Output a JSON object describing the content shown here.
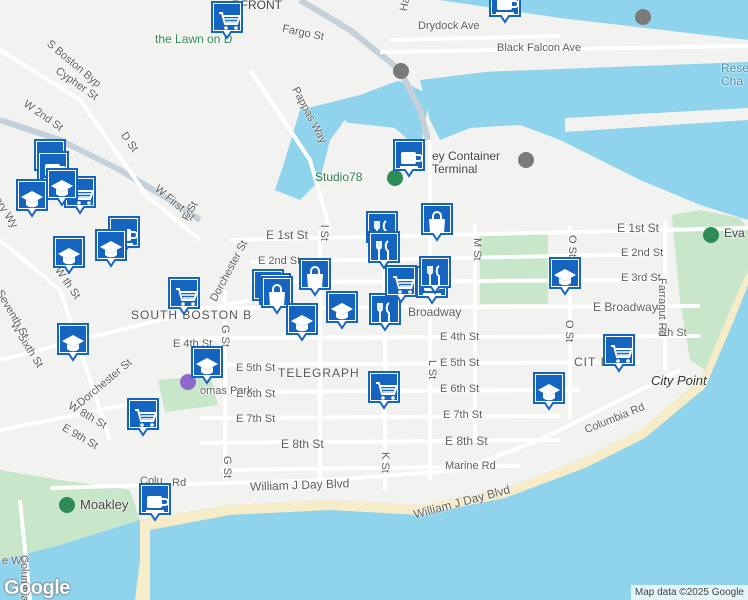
{
  "map": {
    "attribution": "Map data ©2025 Google",
    "logo_text": "Google",
    "colors": {
      "water": "#8fd3ec",
      "land": "#f2f2f0",
      "park": "#c8e6c9",
      "beach": "#f7ecc8",
      "road": "#ffffff",
      "highway": "#c5d1da",
      "marker": "#1565c0"
    },
    "labels": {
      "waterfront": "RFRONT",
      "drydock": "Drydock Ave",
      "black_falcon": "Black Falcon Ave",
      "fargo": "Fargo St",
      "lawn_on_d": "the Lawn on D",
      "boston_bypass": "S Boston Byp",
      "cypher": "Cypher St",
      "w2nd": "W 2nd St",
      "d_st": "D St",
      "pappas": "Pappas Way",
      "studio78": "Studio78",
      "container": "ey Container\nTerminal",
      "w_first": "W First St",
      "f_st": "F St",
      "e_1st": "E 1st St",
      "e_1st_r": "E 1st St",
      "e_2nd_l": "E 2nd St",
      "e_2nd_r": "E 2nd St",
      "e_3rd": "E 3rd St",
      "broadway": "Broadway",
      "e_broadway": "E Broadway",
      "south_boston": "SOUTH BOSTON B",
      "telegraph": "TELEGRAPH",
      "e_4th": "E 4th St",
      "e_4th_r": "4th St",
      "e_5th_l": "E 5th St",
      "e_5th_r": "E 5th St",
      "e_6th_l": "E 6th St",
      "e_6th_r": "E 6th St",
      "e_7th_l": "E 7th St",
      "e_7th_r": "E 7th St",
      "e_8th": "E 8th St",
      "e_8th_r": "E 8th St",
      "w_8th": "W 8th St",
      "e_9th": "E 9th St",
      "marine": "Marine Rd",
      "william_day": "William J Day Blvd",
      "william_day_r": "William J Day Blvd",
      "columbia": "Columbia Rd",
      "columbia_l": "Colu",
      "columbia_l2": "Rd",
      "city_point": "City Point",
      "city_pt_hood": "CIT    INT",
      "farragut": "Farragut Rd",
      "moakley": "Moakley",
      "dorchester": "Dorchester St",
      "dorchester2": "Dorchester St",
      "g_st": "G St",
      "g_st2": "G St",
      "k_st": "K St",
      "l_st": "L St",
      "m_st": "M St",
      "o_st": "O St",
      "thomas": "omas Park",
      "evans": "Eva",
      "reserved": "Rese\nCha",
      "harbor": "Har",
      "w_sixth": "W Sixth St",
      "seventh": "Seventh St",
      "ary_wy": "ery Wy",
      "wy": "e Wy",
      "e4th_small": "E 4th St",
      "w_th": "W th St",
      "e_2nd_c": "E 2nd St",
      "ist": "l St"
    },
    "markers": [
      {
        "icon": "cart-icon",
        "kind": "grocery"
      },
      {
        "icon": "coffee-icon",
        "kind": "cafe"
      },
      {
        "icon": "coffee-icon",
        "kind": "cafe"
      },
      {
        "icon": "coffee-icon",
        "kind": "cafe"
      },
      {
        "icon": "school-icon",
        "kind": "school"
      },
      {
        "icon": "cart-icon",
        "kind": "grocery"
      },
      {
        "icon": "school-icon",
        "kind": "school"
      },
      {
        "icon": "school-icon",
        "kind": "school"
      },
      {
        "icon": "coffee-icon",
        "kind": "cafe"
      },
      {
        "icon": "school-icon",
        "kind": "school"
      },
      {
        "icon": "cart-icon",
        "kind": "grocery"
      },
      {
        "icon": "school-icon",
        "kind": "school"
      },
      {
        "icon": "school-icon",
        "kind": "school"
      },
      {
        "icon": "cart-icon",
        "kind": "grocery"
      },
      {
        "icon": "coffee-icon",
        "kind": "cafe"
      },
      {
        "icon": "restaurant-icon",
        "kind": "restaurant"
      },
      {
        "icon": "bag-icon",
        "kind": "shopping"
      },
      {
        "icon": "restaurant-icon",
        "kind": "restaurant"
      },
      {
        "icon": "bag-icon",
        "kind": "shopping"
      },
      {
        "icon": "bag-icon",
        "kind": "shopping"
      },
      {
        "icon": "bag-icon",
        "kind": "shopping"
      },
      {
        "icon": "bag-icon",
        "kind": "shopping"
      },
      {
        "icon": "school-icon",
        "kind": "school"
      },
      {
        "icon": "school-icon",
        "kind": "school"
      },
      {
        "icon": "restaurant-icon",
        "kind": "restaurant"
      },
      {
        "icon": "cart-icon",
        "kind": "grocery"
      },
      {
        "icon": "coffee-icon",
        "kind": "cafe"
      },
      {
        "icon": "restaurant-icon",
        "kind": "restaurant"
      },
      {
        "icon": "school-icon",
        "kind": "school"
      },
      {
        "icon": "cart-icon",
        "kind": "grocery"
      },
      {
        "icon": "cart-icon",
        "kind": "grocery"
      },
      {
        "icon": "school-icon",
        "kind": "school"
      },
      {
        "icon": "coffee-icon",
        "kind": "cafe"
      }
    ]
  }
}
